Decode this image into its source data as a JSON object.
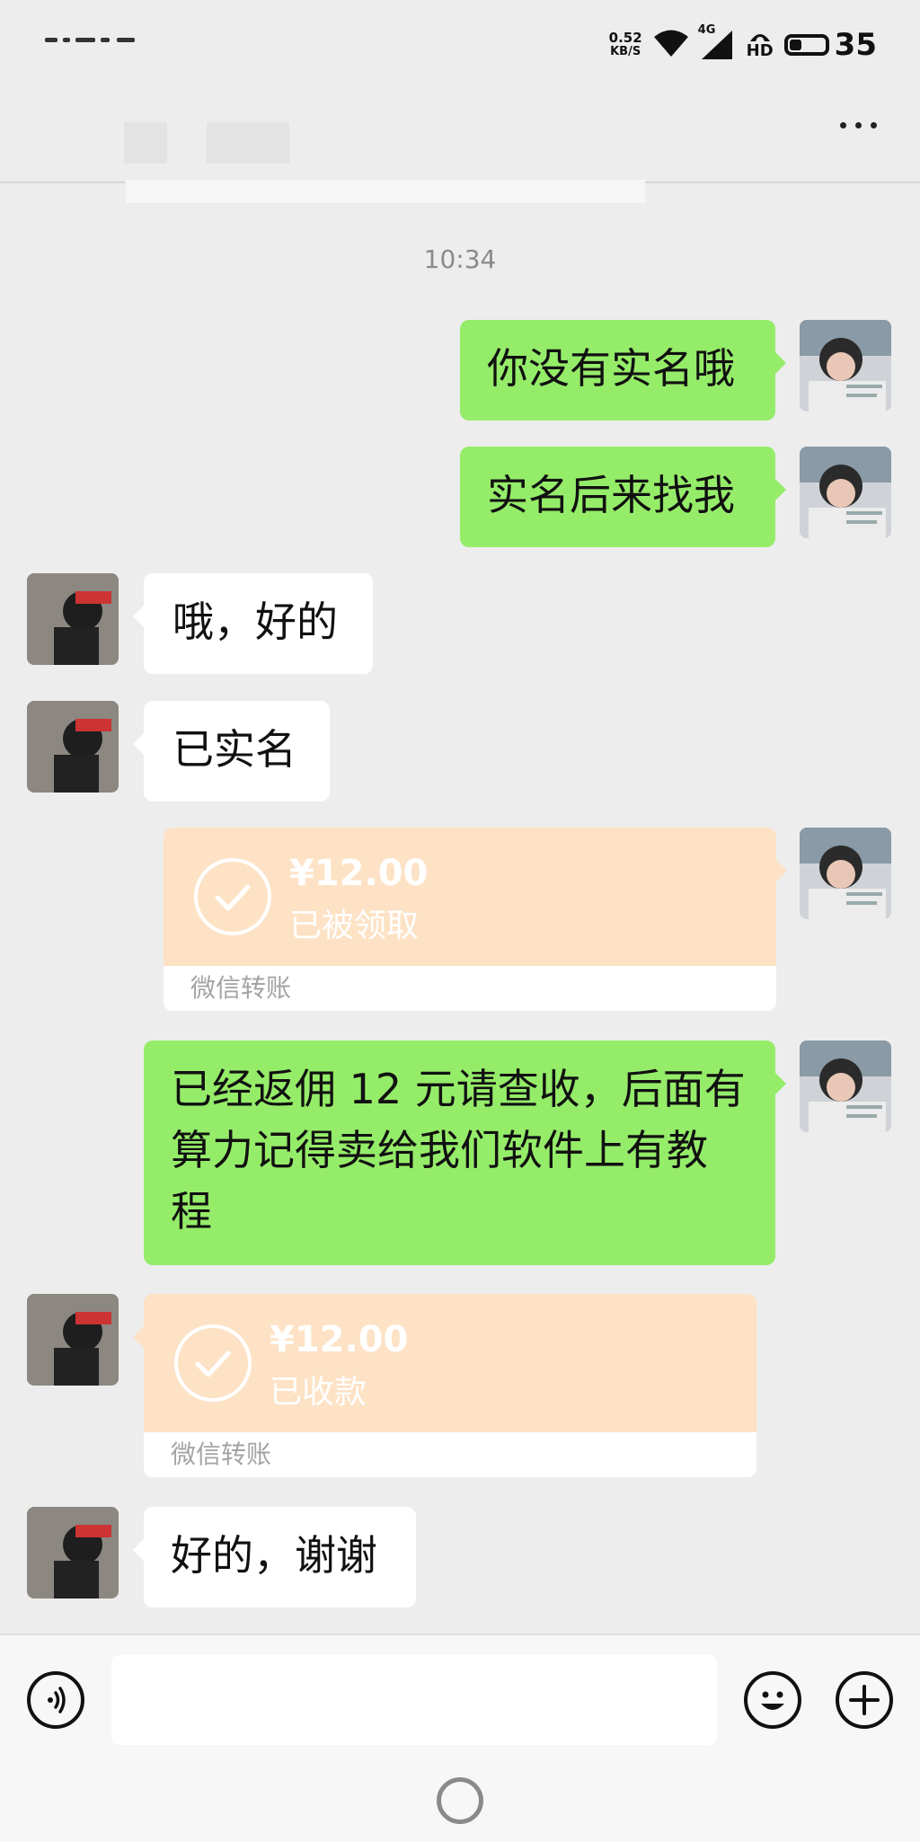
{
  "status_bar": {
    "net_speed": "0.52",
    "net_unit": "KB/S",
    "cell": "4G",
    "hd": "HD",
    "battery": "35"
  },
  "chat": {
    "timestamp": "10:34",
    "messages": [
      {
        "type": "text",
        "side": "right",
        "text": "你没有实名哦"
      },
      {
        "type": "text",
        "side": "right",
        "text": "实名后来找我"
      },
      {
        "type": "text",
        "side": "left",
        "text": "哦，好的"
      },
      {
        "type": "text",
        "side": "left",
        "text": "已实名"
      },
      {
        "type": "transfer",
        "side": "right",
        "amount": "¥12.00",
        "status": "已被领取",
        "footer": "微信转账"
      },
      {
        "type": "text",
        "side": "right",
        "lines": [
          "已经返佣 12 元请查收，后面有",
          "算力记得卖给我们软件上有教",
          "程"
        ]
      },
      {
        "type": "transfer",
        "side": "left",
        "amount": "¥12.00",
        "status": "已收款",
        "footer": "微信转账"
      },
      {
        "type": "text",
        "side": "left",
        "text": "好的，谢谢"
      }
    ]
  },
  "icons": {
    "voice": "voice-input-icon",
    "emoji": "emoji-icon",
    "plus": "plus-icon",
    "more": "more-options-icon"
  },
  "colors": {
    "sent_bubble": "#95ec69",
    "received_bubble": "#ffffff",
    "transfer_card": "#fde2c5",
    "background": "#ededed"
  }
}
